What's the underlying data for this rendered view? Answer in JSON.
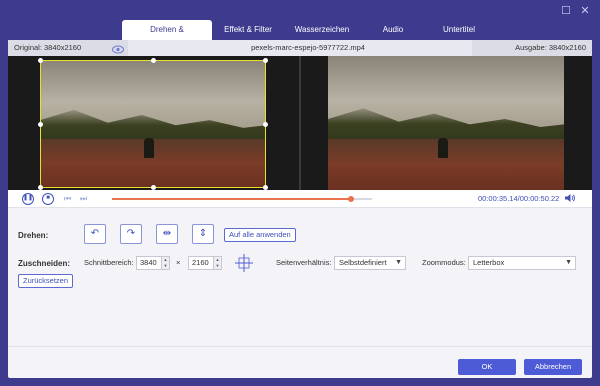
{
  "window": {
    "minimize_glyph": "☐",
    "close_glyph": "✕"
  },
  "tabs": [
    {
      "label": "Drehen & Zuschneiden",
      "active": true
    },
    {
      "label": "Effekt & Filter",
      "active": false
    },
    {
      "label": "Wasserzeichen",
      "active": false
    },
    {
      "label": "Audio",
      "active": false
    },
    {
      "label": "Untertitel",
      "active": false
    }
  ],
  "infobar": {
    "original": "Original: 3840x2160",
    "filename": "pexels-marc-espejo-5977722.mp4",
    "output": "Ausgabe: 3840x2160"
  },
  "playback": {
    "progress": 0.92,
    "timecode": "00:00:35.14/00:00:50.22"
  },
  "rotate": {
    "label": "Drehen:",
    "apply_all": "Auf alle anwenden"
  },
  "crop": {
    "label": "Zuschneiden:",
    "area_label": "Schnittbereich:",
    "width": "3840",
    "times": "×",
    "height": "2160",
    "aspect_label": "Seitenverhältnis:",
    "aspect_value": "Selbstdefiniert",
    "zoom_label": "Zoommodus:",
    "zoom_value": "Letterbox",
    "reset": "Zurücksetzen"
  },
  "footer": {
    "ok": "OK",
    "cancel": "Abbrechen"
  },
  "colors": {
    "accent": "#4d5cd6",
    "progress": "#e8724c",
    "window_bg": "#3e3b8f",
    "crop_border": "#e8e030"
  }
}
